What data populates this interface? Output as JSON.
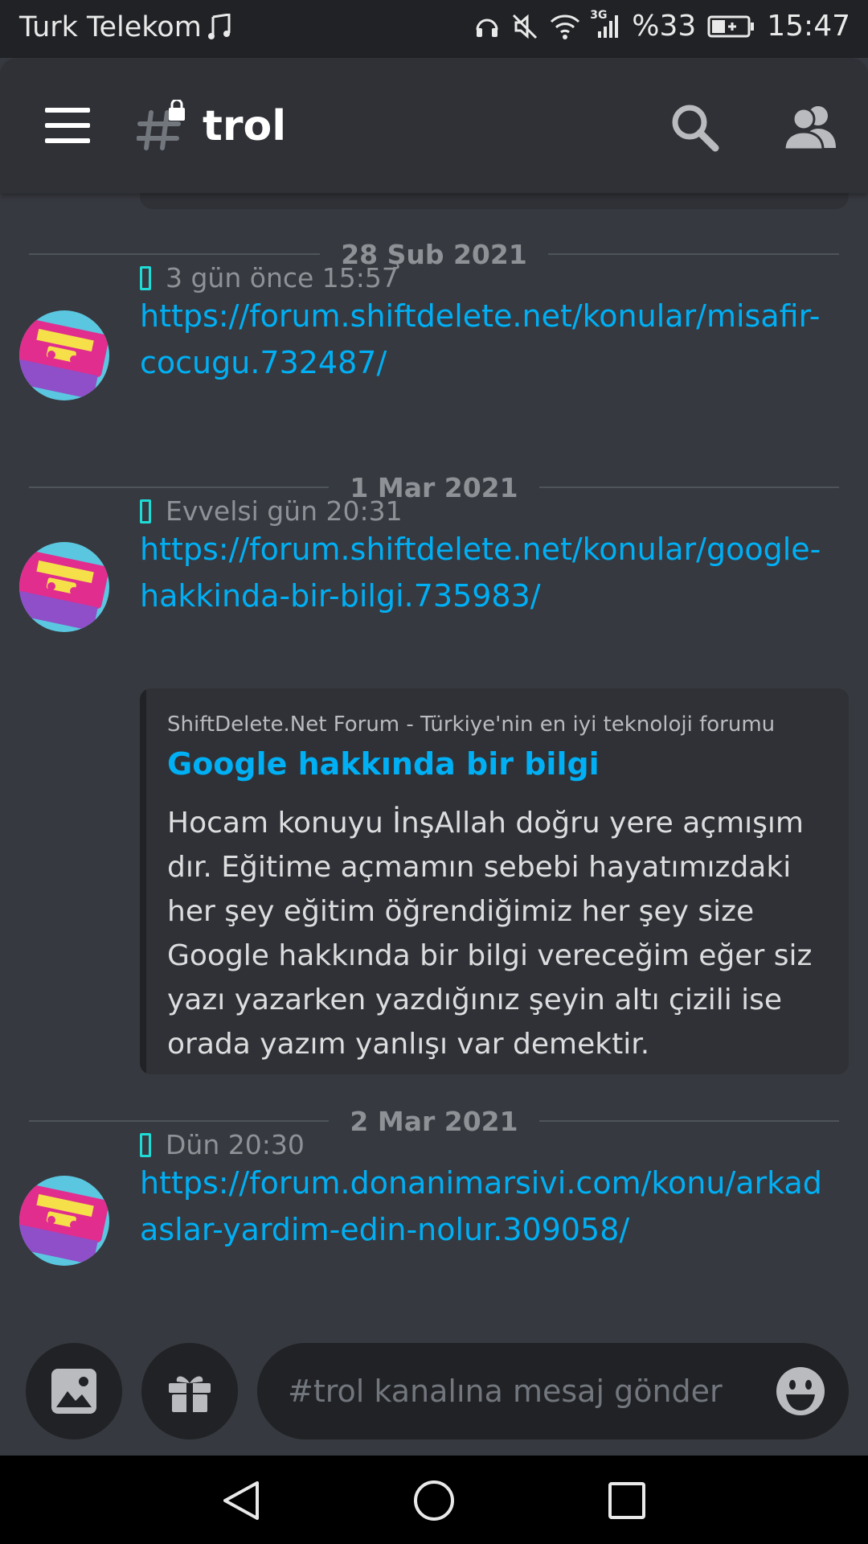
{
  "status_bar": {
    "carrier": "Turk Telekom",
    "network": "3G",
    "battery": "%33",
    "time": "15:47"
  },
  "header": {
    "channel_name": "trol",
    "icons": [
      "menu-icon",
      "locked-hash-icon",
      "search-icon",
      "members-icon"
    ]
  },
  "dividers": [
    "28 Şub 2021",
    "1 Mar 2021",
    "2 Mar 2021"
  ],
  "messages": [
    {
      "time": "3 gün önce 15:57",
      "link": "https://forum.shiftdelete.net/konular/misafir-cocugu.732487/"
    },
    {
      "time": "Evvelsi gün 20:31",
      "link": "https://forum.shiftdelete.net/konular/google-hakkinda-bir-bilgi.735983/",
      "embed": {
        "provider": "ShiftDelete.Net Forum - Türkiye'nin en iyi teknoloji forumu",
        "title": "Google hakkında bir bilgi",
        "description": "Hocam konuyu İnşAllah doğru yere açmışım dır. Eğitime açmamın sebebi hayatımızdaki her şey eğitim öğrendiğimiz her şey size Google hakkında bir bilgi vereceğim eğer siz yazı yazarken yazdığınız şeyin altı çizili ise orada yazım yanlışı var demektir."
      }
    },
    {
      "time": "Dün 20:30",
      "link": "https://forum.donanimarsivi.com/konu/arkadaslar-yardim-edin-nolur.309058/"
    }
  ],
  "composer": {
    "placeholder": "#trol kanalına mesaj gönder",
    "icons": [
      "image-icon",
      "gift-icon",
      "emoji-icon"
    ]
  },
  "colors": {
    "background": "#36393f",
    "header": "#2f3136",
    "link": "#00aff4",
    "input": "#202225"
  }
}
